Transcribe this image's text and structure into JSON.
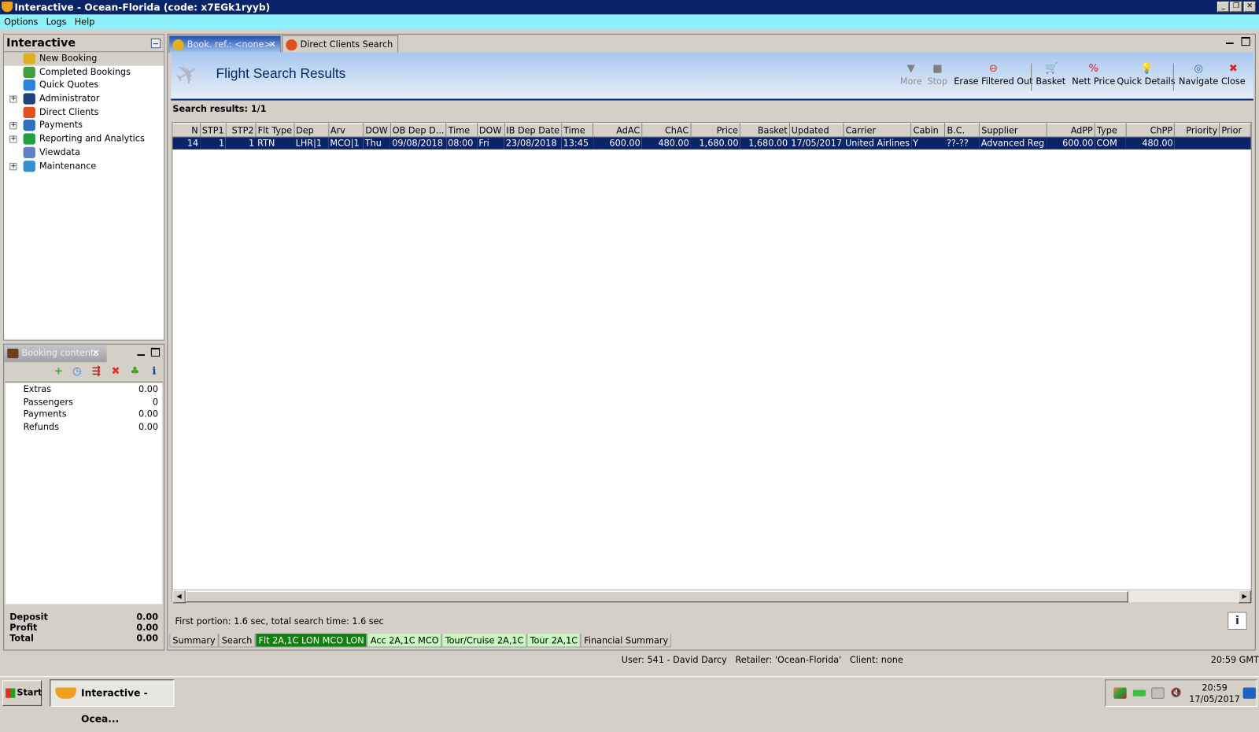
{
  "window": {
    "title": "Interactive - Ocean-Florida (code: x7EGk1ryyb)"
  },
  "menu": [
    "Options",
    "Logs",
    "Help"
  ],
  "nav": {
    "title": "Interactive",
    "items": [
      {
        "label": "New Booking",
        "expandable": false,
        "selected": true,
        "color": "#e0b020"
      },
      {
        "label": "Completed Bookings",
        "expandable": false,
        "color": "#40a040"
      },
      {
        "label": "Quick Quotes",
        "expandable": false,
        "color": "#3080e0"
      },
      {
        "label": "Administrator",
        "expandable": true,
        "color": "#204080"
      },
      {
        "label": "Direct Clients",
        "expandable": false,
        "color": "#e05020"
      },
      {
        "label": "Payments",
        "expandable": true,
        "color": "#3070c0"
      },
      {
        "label": "Reporting and Analytics",
        "expandable": true,
        "color": "#20a040"
      },
      {
        "label": "Viewdata",
        "expandable": false,
        "color": "#6080c0"
      },
      {
        "label": "Maintenance",
        "expandable": true,
        "color": "#3090d0"
      }
    ]
  },
  "booking": {
    "tab": "Booking contents",
    "rows": [
      {
        "label": "Extras",
        "value": "0.00"
      },
      {
        "label": "Passengers",
        "value": "0"
      },
      {
        "label": "Payments",
        "value": "0.00"
      },
      {
        "label": "Refunds",
        "value": "0.00"
      }
    ],
    "totals": [
      {
        "label": "Deposit",
        "value": "0.00"
      },
      {
        "label": "Profit",
        "value": "0.00"
      },
      {
        "label": "Total",
        "value": "0.00"
      }
    ]
  },
  "tabs": [
    {
      "label": "Book. ref.: <none>",
      "active": true
    },
    {
      "label": "Direct Clients Search",
      "active": false
    }
  ],
  "header": {
    "title": "Flight Search Results"
  },
  "toolbar": [
    {
      "label": "More",
      "icon": "▼",
      "disabled": true,
      "color": "#808080"
    },
    {
      "label": "Stop",
      "icon": "■",
      "disabled": true,
      "color": "#808080"
    },
    {
      "label": "Erase Filtered Out",
      "icon": "⊖",
      "disabled": false,
      "color": "#d03030"
    },
    {
      "label": "Basket",
      "icon": "🛒",
      "disabled": false,
      "color": "#c02020"
    },
    {
      "label": "Nett Price",
      "icon": "%",
      "disabled": false,
      "color": "#d02020"
    },
    {
      "label": "Quick Details",
      "icon": "💡",
      "disabled": false,
      "color": "#e0c000"
    },
    {
      "label": "Navigate",
      "icon": "◎",
      "disabled": false,
      "color": "#3060c0"
    },
    {
      "label": "Close",
      "icon": "✖",
      "disabled": false,
      "color": "#e02020"
    }
  ],
  "results": {
    "summary": "Search results: 1/1",
    "columns": [
      "N",
      "STP1",
      "STP2",
      "Flt Type",
      "Dep",
      "Arv",
      "DOW",
      "OB Dep D...",
      "Time",
      "DOW",
      "IB Dep Date",
      "Time",
      "AdAC",
      "ChAC",
      "Price",
      "Basket",
      "Updated",
      "Carrier",
      "Cabin",
      "B.C.",
      "Supplier",
      "AdPP",
      "Type",
      "ChPP",
      "Priority",
      "Prior"
    ],
    "rows": [
      [
        "14",
        "1",
        "1",
        "RTN",
        "LHR|1",
        "MCO|1",
        "Thu",
        "09/08/2018",
        "08:00",
        "Fri",
        "23/08/2018",
        "13:45",
        "600.00",
        "480.00",
        "1,680.00",
        "1,680.00",
        "17/05/2017",
        "United Airlines",
        "Y",
        "??-??",
        "Advanced Reg",
        "600.00",
        "COM",
        "480.00",
        "",
        ""
      ]
    ]
  },
  "status": "First portion: 1.6 sec, total search time: 1.6 sec",
  "bottom_tabs": [
    {
      "label": "Summary",
      "bg": "#d4d0c8",
      "fg": "#000000"
    },
    {
      "label": "Search",
      "bg": "#d4d0c8",
      "fg": "#000000"
    },
    {
      "label": "Flt 2A,1C LON MCO LON",
      "bg": "#108010",
      "fg": "#ffffff"
    },
    {
      "label": "Acc 2A,1C MCO",
      "bg": "#c8f8c0",
      "fg": "#000000"
    },
    {
      "label": "Tour/Cruise 2A,1C",
      "bg": "#c8f8c0",
      "fg": "#000000"
    },
    {
      "label": "Tour 2A,1C",
      "bg": "#c8f8c0",
      "fg": "#000000"
    },
    {
      "label": "Financial Summary",
      "bg": "#d4d0c8",
      "fg": "#000000"
    }
  ],
  "userline": "User: 541 - David Darcy   Retailer: 'Ocean-Florida'   Client: none",
  "gmt_time": "20:59 GMT",
  "taskbar": {
    "start": "Start",
    "task": "Interactive - Ocea...",
    "time": "20:59",
    "date": "17/05/2017"
  }
}
